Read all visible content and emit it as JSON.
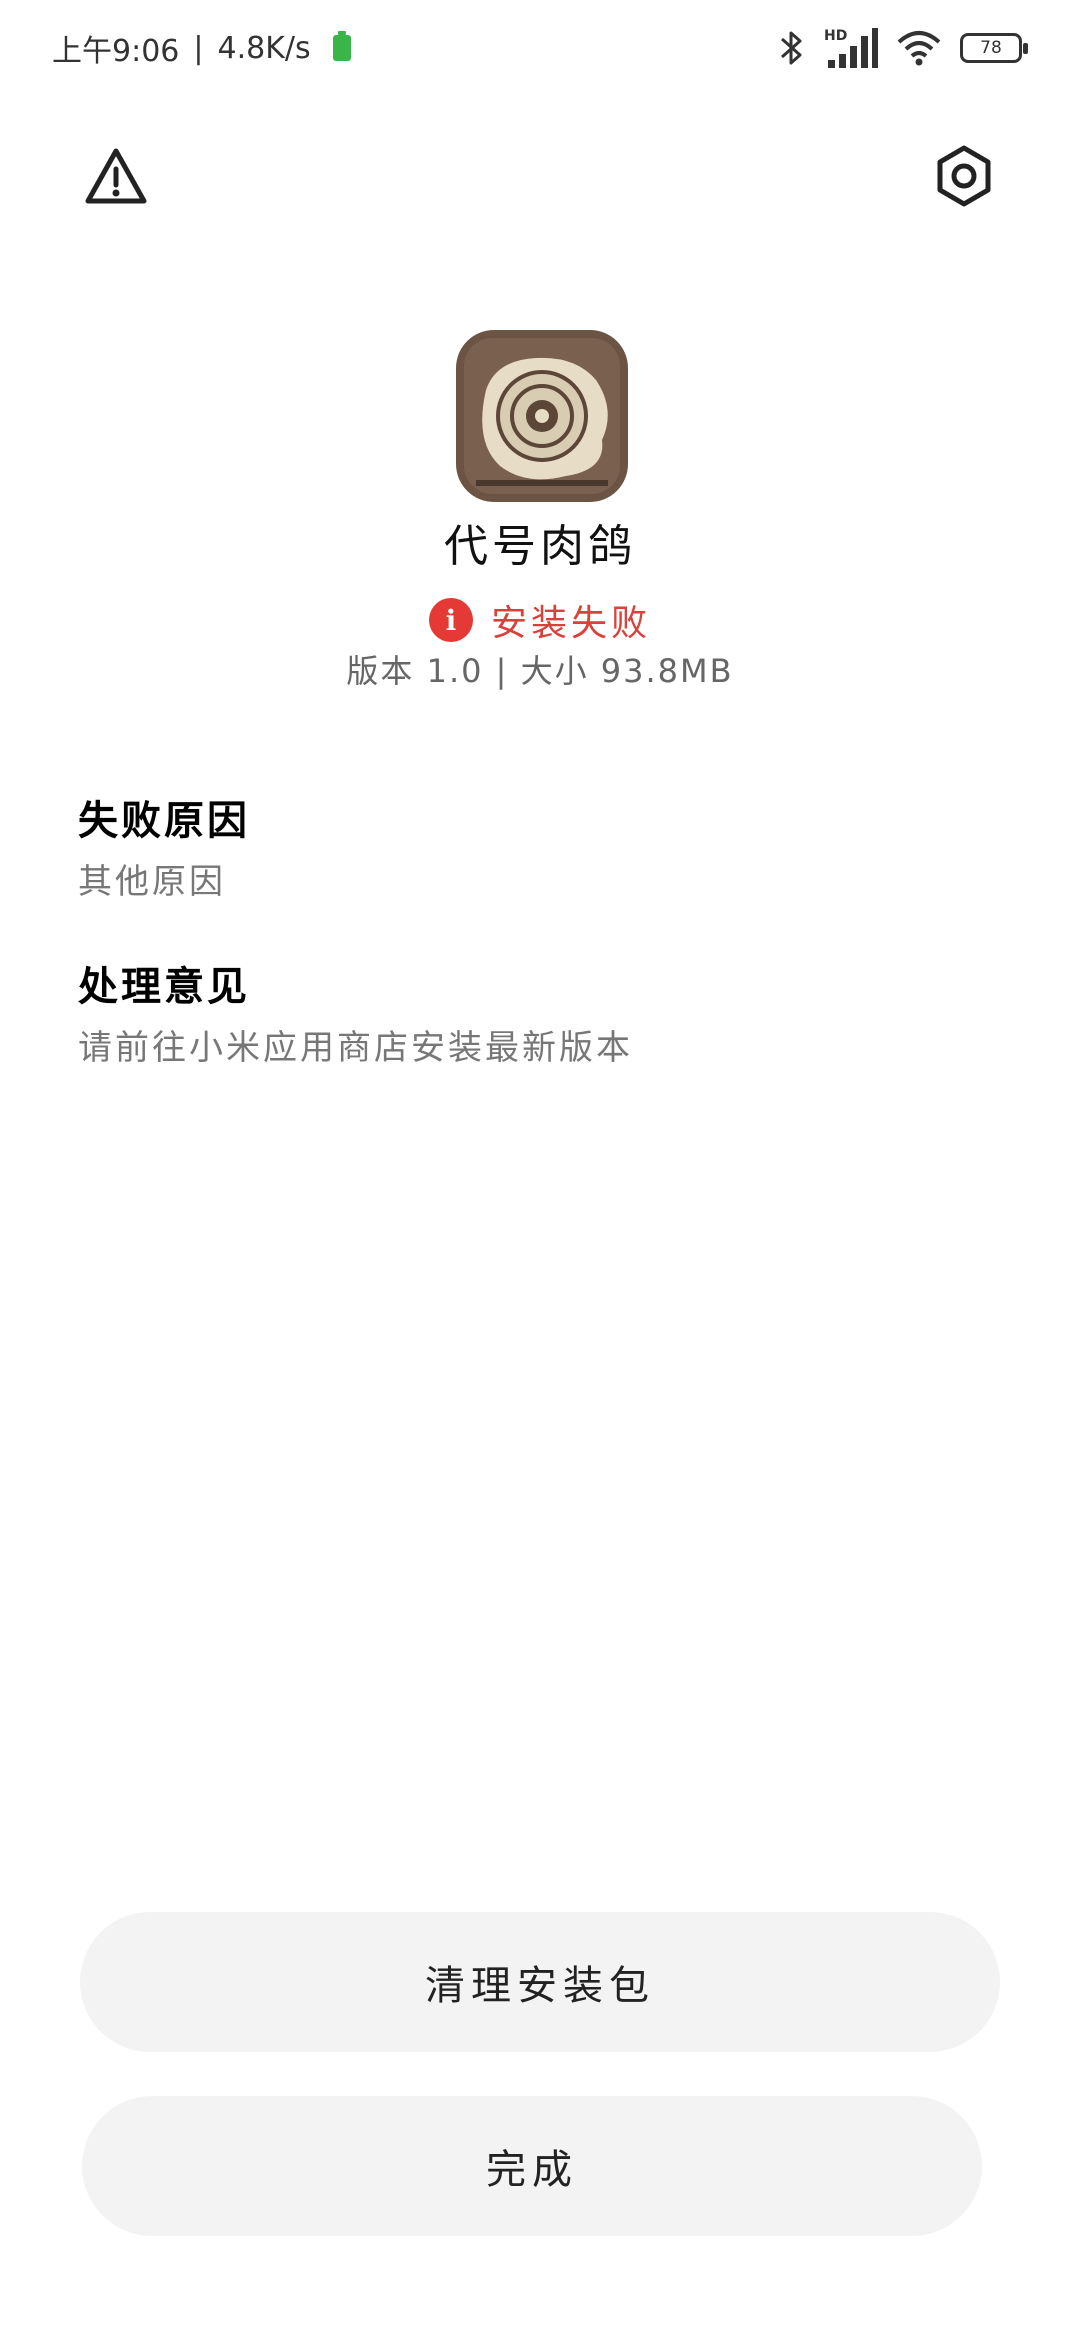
{
  "status_bar": {
    "time": "上午9:06",
    "net_speed": "4.8K/s",
    "battery_level": "78",
    "hd_label": "HD",
    "icons": [
      "battery-saver-icon",
      "bluetooth-icon",
      "signal-icon",
      "wifi-icon",
      "battery-icon"
    ]
  },
  "toolbar": {
    "left_icon": "warning-icon",
    "right_icon": "settings-icon"
  },
  "app": {
    "name": "代号肉鸽",
    "status": "安装失败",
    "status_color": "#d9413b",
    "meta": "版本 1.0 | 大小 93.8MB"
  },
  "sections": {
    "reason_title": "失败原因",
    "reason_detail": "其他原因",
    "advice_title": "处理意见",
    "advice_detail": "请前往小米应用商店安装最新版本"
  },
  "buttons": {
    "clean": "清理安装包",
    "done": "完成"
  }
}
